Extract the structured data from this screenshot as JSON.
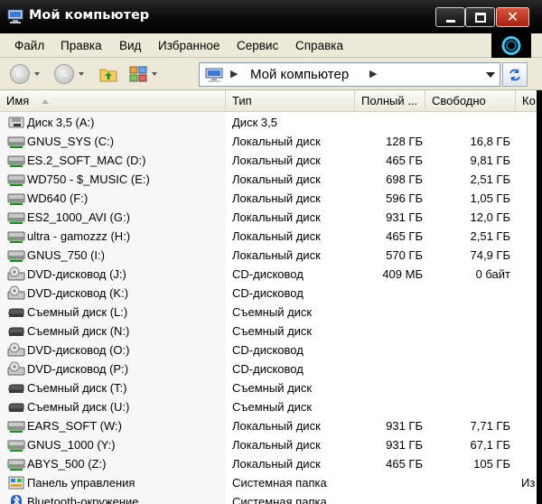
{
  "window": {
    "title": "Мой компьютер"
  },
  "menu": [
    "Файл",
    "Правка",
    "Вид",
    "Избранное",
    "Сервис",
    "Справка"
  ],
  "address": {
    "text": "Мой компьютер"
  },
  "columns": {
    "name": "Имя",
    "type": "Тип",
    "total": "Полный ...",
    "free": "Свободно",
    "extra": "Ко"
  },
  "items": [
    {
      "name": "Диск 3,5 (A:)",
      "type": "Диск 3,5",
      "total": "",
      "free": "",
      "extra": "",
      "icon": "floppy-drive-icon"
    },
    {
      "name": "GNUS_SYS (C:)",
      "type": "Локальный диск",
      "total": "128 ГБ",
      "free": "16,8 ГБ",
      "extra": "",
      "icon": "hard-drive-icon"
    },
    {
      "name": "ES.2_SOFT_MAC (D:)",
      "type": "Локальный диск",
      "total": "465 ГБ",
      "free": "9,81 ГБ",
      "extra": "",
      "icon": "hard-drive-icon"
    },
    {
      "name": "WD750 - $_MUSIC (E:)",
      "type": "Локальный диск",
      "total": "698 ГБ",
      "free": "2,51 ГБ",
      "extra": "",
      "icon": "hard-drive-icon"
    },
    {
      "name": "WD640 (F:)",
      "type": "Локальный диск",
      "total": "596 ГБ",
      "free": "1,05 ГБ",
      "extra": "",
      "icon": "hard-drive-icon"
    },
    {
      "name": "ES2_1000_AVI (G:)",
      "type": "Локальный диск",
      "total": "931 ГБ",
      "free": "12,0 ГБ",
      "extra": "",
      "icon": "hard-drive-icon"
    },
    {
      "name": "ultra - gamozzz (H:)",
      "type": "Локальный диск",
      "total": "465 ГБ",
      "free": "2,51 ГБ",
      "extra": "",
      "icon": "hard-drive-icon"
    },
    {
      "name": "GNUS_750 (I:)",
      "type": "Локальный диск",
      "total": "570 ГБ",
      "free": "74,9 ГБ",
      "extra": "",
      "icon": "hard-drive-icon"
    },
    {
      "name": "DVD-дисковод (J:)",
      "type": "CD-дисковод",
      "total": "409 МБ",
      "free": "0 байт",
      "extra": "",
      "icon": "dvd-drive-icon"
    },
    {
      "name": "DVD-дисковод (K:)",
      "type": "CD-дисковод",
      "total": "",
      "free": "",
      "extra": "",
      "icon": "dvd-drive-icon"
    },
    {
      "name": "Съемный диск (L:)",
      "type": "Съемный диск",
      "total": "",
      "free": "",
      "extra": "",
      "icon": "removable-drive-icon"
    },
    {
      "name": "Съемный диск (N:)",
      "type": "Съемный диск",
      "total": "",
      "free": "",
      "extra": "",
      "icon": "removable-drive-icon"
    },
    {
      "name": "DVD-дисковод (O:)",
      "type": "CD-дисковод",
      "total": "",
      "free": "",
      "extra": "",
      "icon": "dvd-drive-icon"
    },
    {
      "name": "DVD-дисковод (P:)",
      "type": "CD-дисковод",
      "total": "",
      "free": "",
      "extra": "",
      "icon": "dvd-drive-icon"
    },
    {
      "name": "Съемный диск (T:)",
      "type": "Съемный диск",
      "total": "",
      "free": "",
      "extra": "",
      "icon": "removable-drive-icon"
    },
    {
      "name": "Съемный диск (U:)",
      "type": "Съемный диск",
      "total": "",
      "free": "",
      "extra": "",
      "icon": "removable-drive-icon"
    },
    {
      "name": "EARS_SOFT (W:)",
      "type": "Локальный диск",
      "total": "931 ГБ",
      "free": "7,71 ГБ",
      "extra": "",
      "icon": "hard-drive-icon"
    },
    {
      "name": "GNUS_1000 (Y:)",
      "type": "Локальный диск",
      "total": "931 ГБ",
      "free": "67,1 ГБ",
      "extra": "",
      "icon": "hard-drive-icon"
    },
    {
      "name": "ABYS_500 (Z:)",
      "type": "Локальный диск",
      "total": "465 ГБ",
      "free": "105 ГБ",
      "extra": "",
      "icon": "hard-drive-icon"
    },
    {
      "name": "Панель управления",
      "type": "Системная папка",
      "total": "",
      "free": "",
      "extra": "Из",
      "icon": "control-panel-icon"
    },
    {
      "name": "Bluetooth-окружение",
      "type": "Системная папка",
      "total": "",
      "free": "",
      "extra": "",
      "icon": "bluetooth-icon"
    }
  ]
}
